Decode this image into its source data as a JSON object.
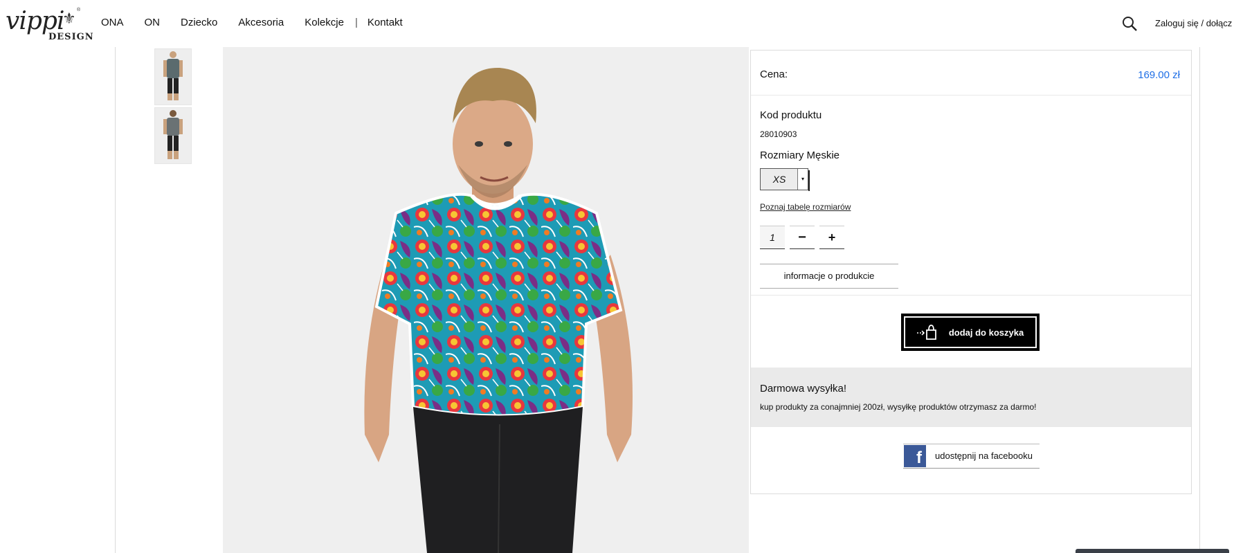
{
  "header": {
    "logo_text": "vippi",
    "logo_sub": "DESIGN",
    "logo_reg": "®",
    "nav": [
      "ONA",
      "ON",
      "Dziecko",
      "Akcesoria",
      "Kolekcje",
      "Kontakt"
    ],
    "separator": "|",
    "login": "Zaloguj się / dołącz d"
  },
  "product": {
    "price_label": "Cena:",
    "price_value": "169.00 zł",
    "code_label": "Kod produktu",
    "code_value": "28010903",
    "size_label": "Rozmiary Męskie",
    "size_selected": "XS",
    "size_table_link": "Poznaj tabelę rozmiarów",
    "quantity": "1",
    "minus": "−",
    "plus": "+",
    "info_button": "informacje o produkcie",
    "cart_button": "dodaj do koszyka",
    "shipping_title": "Darmowa wysyłka!",
    "shipping_text": "kup produkty za conajmniej 200zł, wysyłkę produktów otrzymasz za darmo!",
    "fb_button": "udostępnij na facebooku"
  },
  "colors": {
    "price": "#1f6fe6",
    "facebook": "#3b5998",
    "cart": "#000000"
  },
  "icons": [
    "search-icon",
    "shopping-bag-icon",
    "facebook-icon",
    "chevron-down-icon"
  ]
}
